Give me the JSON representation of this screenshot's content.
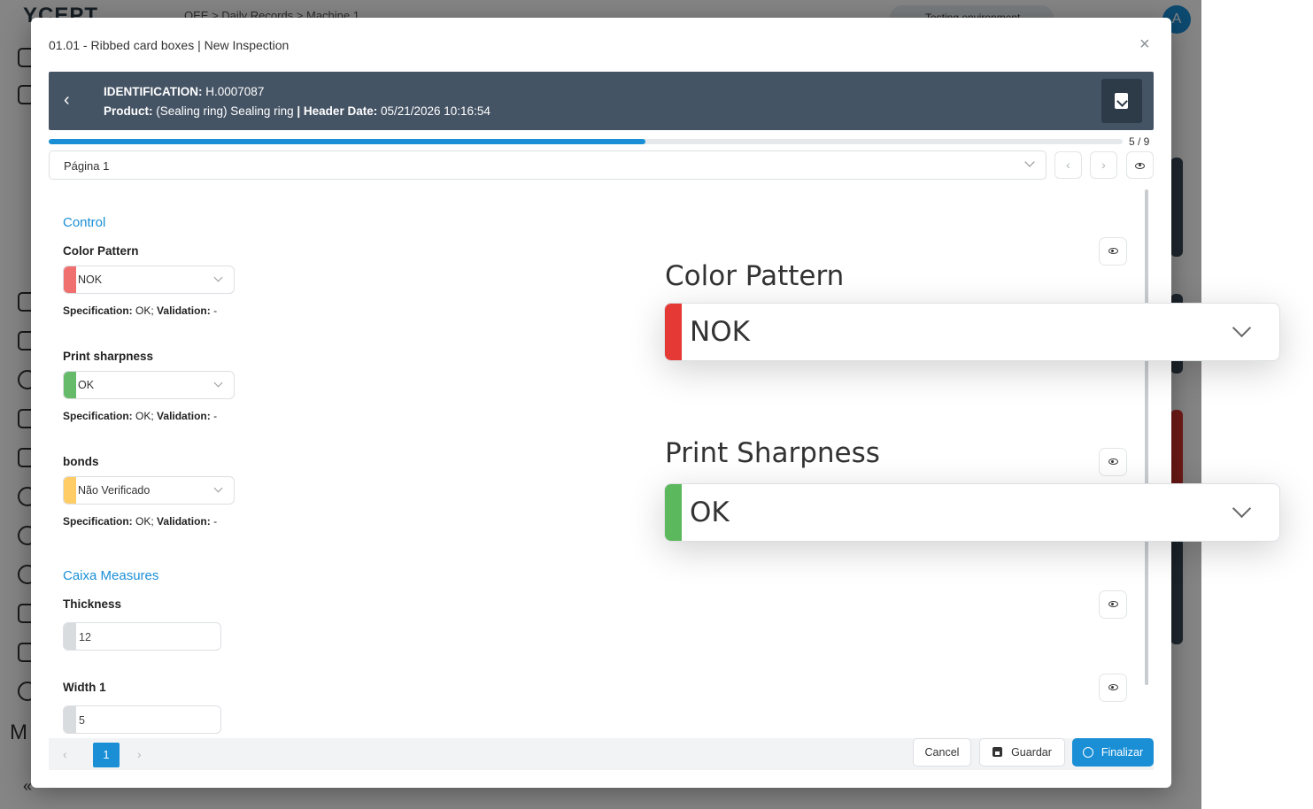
{
  "background": {
    "logo": "YCEPT",
    "breadcrumb": "OEE  >  Daily Records  >  Machine 1",
    "top_button": "Testing environment",
    "avatar": "A",
    "side_letter": "M",
    "collapse": "«"
  },
  "modal": {
    "title": "01.01 - Ribbed card boxes | New Inspection",
    "close": "×"
  },
  "header": {
    "identification_label": "IDENTIFICATION:",
    "identification_value": "H.0007087",
    "product_label": "Product:",
    "product_value": "(Sealing ring) Sealing ring",
    "separator": "|",
    "header_date_label": "Header Date:",
    "header_date_value": "05/21/2026 10:16:54"
  },
  "progress": {
    "current": 5,
    "total": 9,
    "text": "5 / 9"
  },
  "page_select": {
    "value": "Página 1"
  },
  "sections": [
    {
      "title": "Control",
      "fields": [
        {
          "label": "Color Pattern",
          "value": "NOK",
          "status_color": "#f07070",
          "spec_label": "Specification:",
          "spec_value": "OK;",
          "validation_label": "Validation:",
          "validation_value": "-"
        },
        {
          "label": "Print sharpness",
          "value": "OK",
          "status_color": "#66bb6a",
          "spec_label": "Specification:",
          "spec_value": "OK;",
          "validation_label": "Validation:",
          "validation_value": "-"
        },
        {
          "label": "bonds",
          "value": "Não Verificado",
          "status_color": "#ffcc66",
          "spec_label": "Specification:",
          "spec_value": "OK;",
          "validation_label": "Validation:",
          "validation_value": "-"
        }
      ]
    },
    {
      "title": "Caixa Measures",
      "fields": [
        {
          "label": "Thickness",
          "value": "12"
        },
        {
          "label": "Width 1",
          "value": "5"
        }
      ]
    }
  ],
  "pagination": {
    "prev": "‹",
    "current": "1",
    "next": "›"
  },
  "footer": {
    "cancel": "Cancel",
    "save": "Guardar",
    "finish": "Finalizar"
  },
  "zoom": [
    {
      "title": "Color Pattern",
      "value": "NOK",
      "status_color": "#e53935"
    },
    {
      "title": "Print Sharpness",
      "value": "OK",
      "status_color": "#5cb85c"
    }
  ],
  "colors": {
    "accent": "#1a8fd6",
    "header_band": "#455465"
  }
}
